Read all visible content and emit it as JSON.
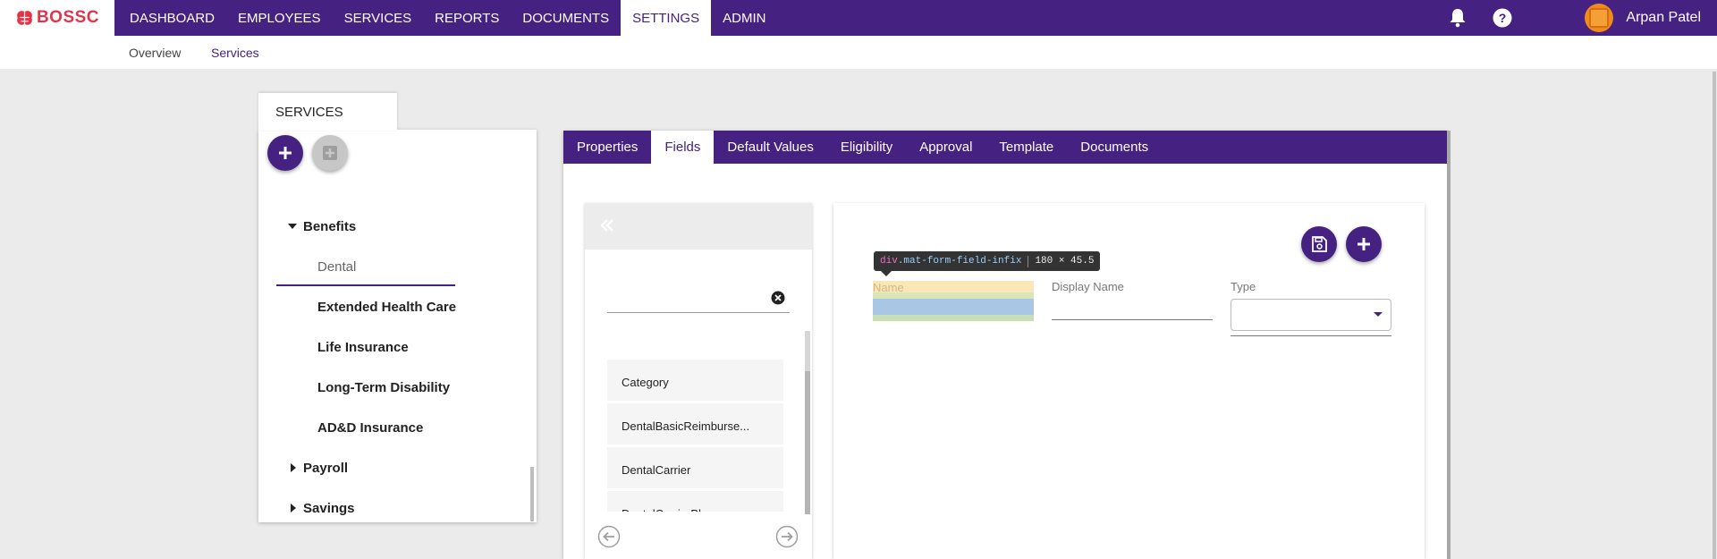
{
  "app": {
    "logo_text": "BOSSC"
  },
  "topnav": {
    "items": [
      {
        "label": "DASHBOARD"
      },
      {
        "label": "EMPLOYEES"
      },
      {
        "label": "SERVICES"
      },
      {
        "label": "REPORTS"
      },
      {
        "label": "DOCUMENTS"
      },
      {
        "label": "SETTINGS",
        "active": true
      },
      {
        "label": "ADMIN"
      }
    ],
    "user_name": "Arpan Patel"
  },
  "subnav": {
    "overview_label": "Overview",
    "services_label": "Services"
  },
  "left_panel": {
    "tab_label": "SERVICES",
    "tree": [
      {
        "label": "Benefits",
        "kind": "group",
        "expanded": true
      },
      {
        "label": "Dental",
        "kind": "leaf",
        "selected": true
      },
      {
        "label": "Extended Health Care",
        "kind": "leaf"
      },
      {
        "label": "Life Insurance",
        "kind": "leaf"
      },
      {
        "label": "Long-Term Disability",
        "kind": "leaf"
      },
      {
        "label": "AD&D Insurance",
        "kind": "leaf"
      },
      {
        "label": "Payroll",
        "kind": "group",
        "expanded": false
      },
      {
        "label": "Savings",
        "kind": "group",
        "expanded": false
      }
    ]
  },
  "detail": {
    "tabs": [
      {
        "label": "Properties"
      },
      {
        "label": "Fields",
        "active": true
      },
      {
        "label": "Default Values"
      },
      {
        "label": "Eligibility"
      },
      {
        "label": "Approval"
      },
      {
        "label": "Template"
      },
      {
        "label": "Documents"
      }
    ],
    "field_list": {
      "search_value": "",
      "items": [
        {
          "label": "Category"
        },
        {
          "label": "DentalBasicReimburse..."
        },
        {
          "label": "DentalCarrier"
        },
        {
          "label": "DentalCarrierPhone"
        }
      ]
    },
    "form": {
      "name_label": "Name",
      "display_name_label": "Display Name",
      "type_label": "Type",
      "type_value": ""
    },
    "devtools_tooltip": {
      "tag": "div",
      "class": ".mat-form-field-infix",
      "size": "180 × 45.5"
    }
  },
  "colors": {
    "primary": "#452181",
    "brand_red": "#e3344a"
  }
}
